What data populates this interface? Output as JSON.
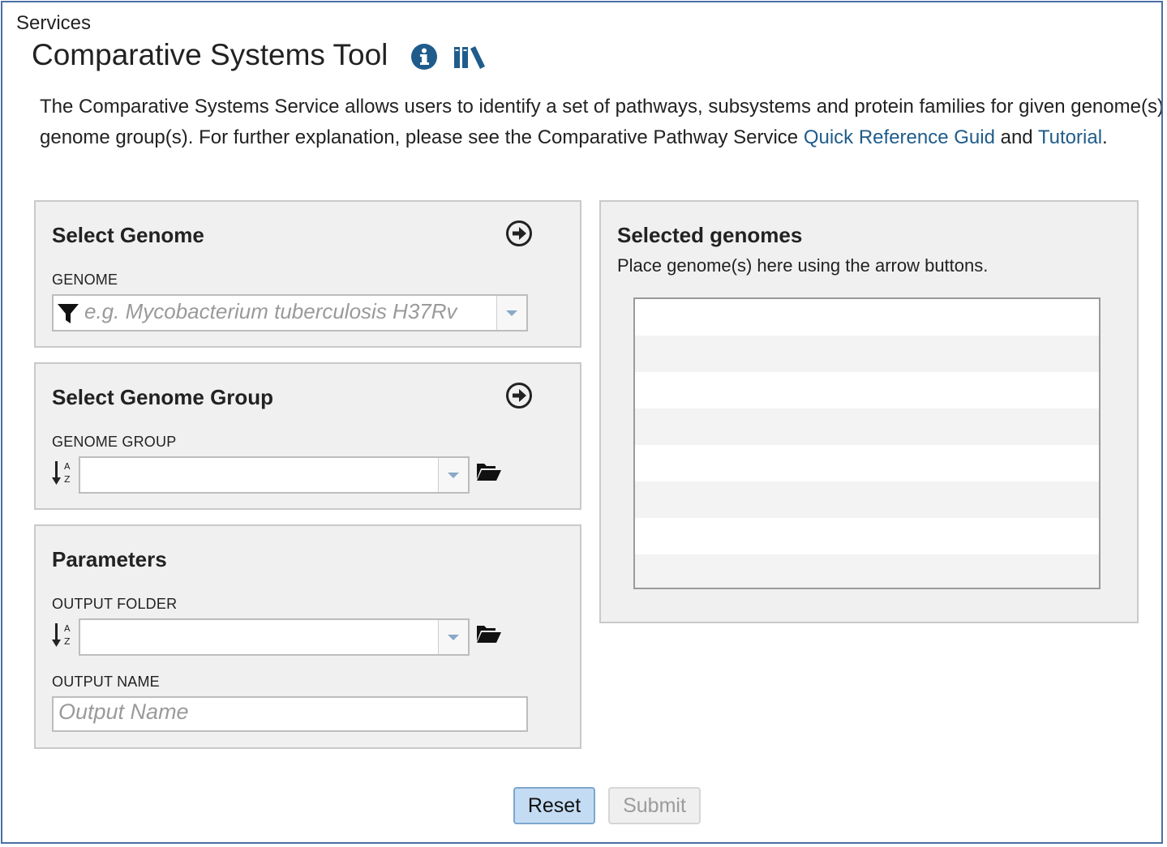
{
  "breadcrumb": "Services",
  "page_title": "Comparative Systems Tool",
  "description": {
    "text_1": "The Comparative Systems Service allows users to identify a set of pathways, subsystems and protein families for given genome(s) or genome group(s). For further explanation, please see the Comparative Pathway Service ",
    "link_quick_reference": "Quick Reference Guid",
    "text_2": " and ",
    "link_tutorial": "Tutorial",
    "text_3": "."
  },
  "select_genome": {
    "title": "Select Genome",
    "field_label": "GENOME",
    "placeholder": "e.g. Mycobacterium tuberculosis H37Rv"
  },
  "select_genome_group": {
    "title": "Select Genome Group",
    "field_label": "GENOME GROUP",
    "value": ""
  },
  "parameters": {
    "title": "Parameters",
    "output_folder_label": "OUTPUT FOLDER",
    "output_folder_value": "",
    "output_name_label": "OUTPUT NAME",
    "output_name_placeholder": "Output Name"
  },
  "selected_genomes": {
    "title": "Selected genomes",
    "hint": "Place genome(s) here using the arrow buttons.",
    "rows": [
      "",
      "",
      "",
      "",
      "",
      "",
      "",
      ""
    ]
  },
  "buttons": {
    "reset": "Reset",
    "submit": "Submit"
  },
  "colors": {
    "link": "#1f5c8b",
    "icon_blue": "#1f5c8b",
    "panel_bg": "#f0f0f1",
    "reset_bg": "#c4dcf3"
  },
  "icons": {
    "info": "info-icon",
    "library": "books-icon",
    "arrow_right_circle": "arrow-circle-right-icon",
    "filter": "filter-icon",
    "sort_alpha": "sort-alpha-icon",
    "folder_open": "folder-open-icon",
    "dropdown": "chevron-down-icon"
  }
}
